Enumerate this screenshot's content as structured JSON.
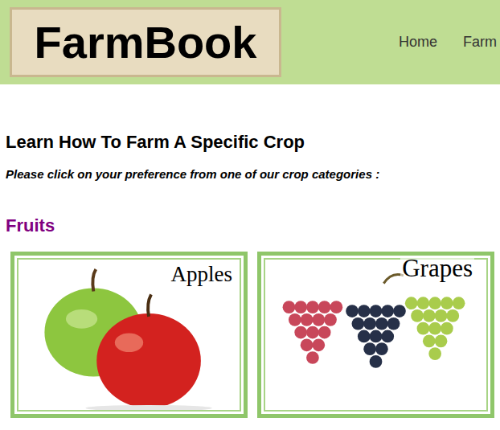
{
  "header": {
    "logo": "FarmBook",
    "nav": [
      {
        "label": "Home"
      },
      {
        "label": "Farm"
      }
    ]
  },
  "page": {
    "title": "Learn How To Farm A Specific Crop",
    "subtitle": "Please click on your preference from one of our crop categories :"
  },
  "sections": [
    {
      "title": "Fruits",
      "cards": [
        {
          "label": "Apples",
          "kind": "apples"
        },
        {
          "label": "Grapes",
          "kind": "grapes"
        }
      ]
    }
  ]
}
